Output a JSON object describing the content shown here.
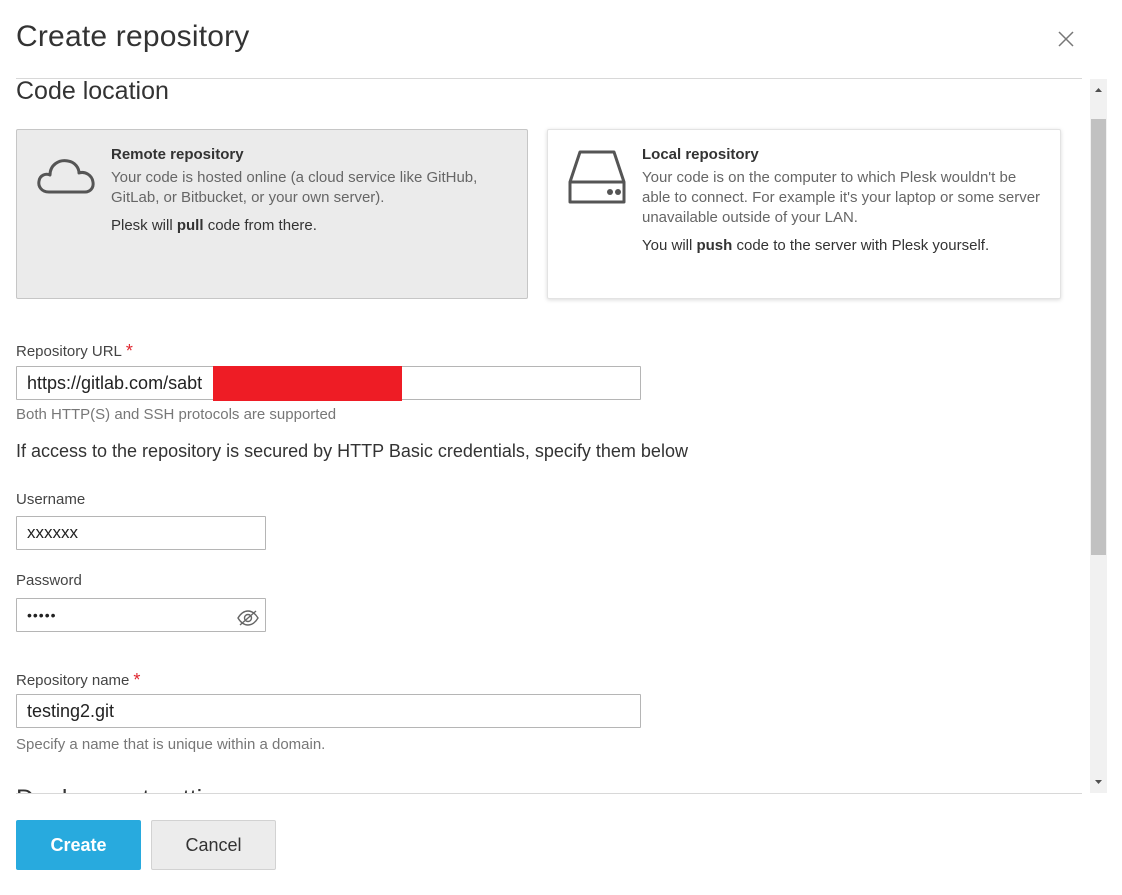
{
  "dialog": {
    "title": "Create repository",
    "close_icon": "close-icon"
  },
  "code_location": {
    "title": "Code location",
    "next_section_title": "Deployment settings",
    "remote": {
      "title": "Remote repository",
      "description": "Your code is hosted online (a cloud service like GitHub, GitLab, or Bitbucket, or your own server).",
      "note_before": "Plesk will ",
      "note_bold": "pull",
      "note_after": " code from there.",
      "icon": "cloud-icon",
      "selected": true
    },
    "local": {
      "title": "Local repository",
      "description": "Your code is on the computer to which Plesk wouldn't be able to connect. For example it's your laptop or some server unavailable outside of your LAN.",
      "note_before": "You will ",
      "note_bold": "push",
      "note_after": " code to the server with Plesk yourself.",
      "icon": "hard-drive-icon",
      "selected": false
    }
  },
  "form": {
    "repo_url": {
      "label": "Repository URL",
      "required_mark": "*",
      "value": "https://gitlab.com/sabt",
      "hint": "Both HTTP(S) and SSH protocols are supported"
    },
    "credentials_info": "If access to the repository is secured by HTTP Basic credentials, specify them below",
    "username": {
      "label": "Username",
      "value": "xxxxxx"
    },
    "password": {
      "label": "Password",
      "value": "•••••",
      "toggle_icon": "eye-slash-icon"
    },
    "repo_name": {
      "label": "Repository name",
      "required_mark": "*",
      "value": "testing2.git",
      "hint": "Specify a name that is unique within a domain."
    }
  },
  "footer": {
    "create_label": "Create",
    "cancel_label": "Cancel"
  },
  "colors": {
    "primary_button": "#28aade",
    "required": "#e0252e",
    "redaction": "#ee1c25"
  }
}
